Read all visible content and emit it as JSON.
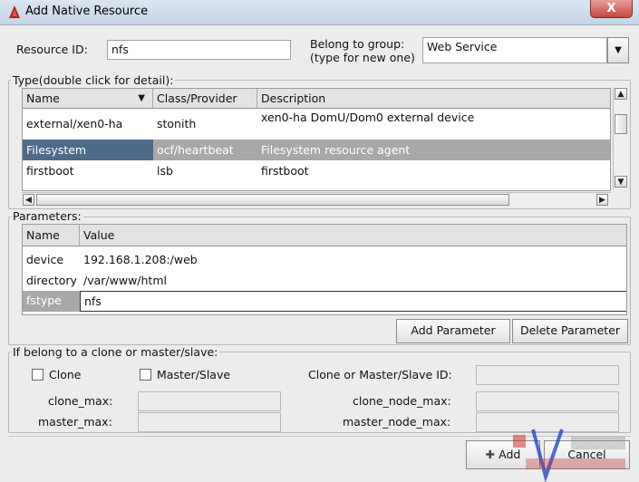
{
  "window": {
    "title": "Add Native Resource",
    "close": "X"
  },
  "form": {
    "resource_id_label": "Resource ID:",
    "resource_id_value": "nfs",
    "group_label_line1": "Belong to group:",
    "group_label_line2": "(type for new one)",
    "group_value": "Web Service"
  },
  "type_section": {
    "legend": "Type(double click for detail):",
    "columns": [
      "Name",
      "Class/Provider",
      "Description"
    ],
    "rows": [
      {
        "name": "external/xen0-ha",
        "provider": "stonith",
        "description": "xen0-ha DomU/Dom0 external device"
      },
      {
        "name": "Filesystem",
        "provider": "ocf/heartbeat",
        "description": "Filesystem resource agent"
      },
      {
        "name": "firstboot",
        "provider": "lsb",
        "description": "firstboot"
      }
    ]
  },
  "params_section": {
    "legend": "Parameters:",
    "columns": [
      "Name",
      "Value"
    ],
    "rows": [
      {
        "name": "device",
        "value": "192.168.1.208:/web"
      },
      {
        "name": "directory",
        "value": "/var/www/html"
      },
      {
        "name": "fstype",
        "value": "nfs"
      }
    ],
    "add_button": "Add Parameter",
    "delete_button": "Delete Parameter"
  },
  "clone_section": {
    "legend": "If belong to a clone or master/slave:",
    "clone_label": "Clone",
    "master_slave_label": "Master/Slave",
    "id_label": "Clone or Master/Slave ID:",
    "clone_max_label": "clone_max:",
    "clone_node_max_label": "clone_node_max:",
    "master_max_label": "master_max:",
    "master_node_max_label": "master_node_max:"
  },
  "footer": {
    "add_button": "Add",
    "cancel_button": "Cancel"
  },
  "colors": {
    "selection": "#4d6a8a",
    "selection_row": "#a8a8a8",
    "close": "#c7473c"
  }
}
